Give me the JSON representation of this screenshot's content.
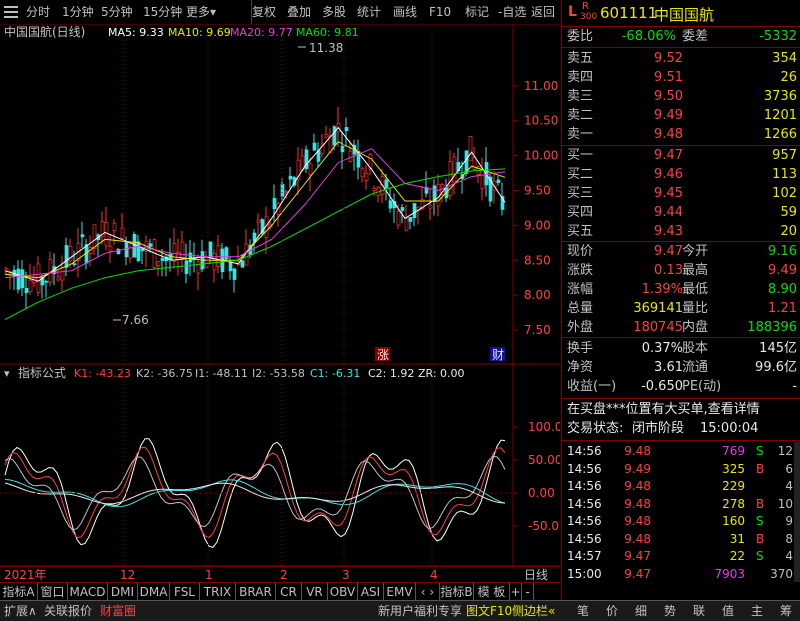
{
  "toolbar": {
    "items": [
      "分时",
      "1分钟",
      "5分钟",
      "15分钟",
      "更多▾",
      "复权",
      "叠加",
      "多股",
      "统计",
      "画线",
      "F10",
      "标记",
      "-自选",
      "返回"
    ]
  },
  "chart": {
    "title": "中国国航(日线)",
    "ma": [
      {
        "label": "MA5: 9.33",
        "color": "#ffffff"
      },
      {
        "label": "MA10: 9.69",
        "color": "#e8e800"
      },
      {
        "label": "MA20: 9.77",
        "color": "#e040e0"
      },
      {
        "label": "MA60: 9.81",
        "color": "#00e000"
      }
    ],
    "price_ticks": [
      "11.00",
      "10.50",
      "10.00",
      "9.50",
      "9.00",
      "8.50",
      "8.00",
      "7.50"
    ],
    "high_label": "11.38",
    "low_label": "7.66",
    "marker_zhang": "涨",
    "marker_cai": "财",
    "indicator": {
      "name": "指标公式",
      "values": [
        {
          "label": "K1: -43.23",
          "color": "#ff4040"
        },
        {
          "label": "K2: -36.75",
          "color": "#c0c0c0"
        },
        {
          "label": "I1: -48.11",
          "color": "#c0c0c0"
        },
        {
          "label": "I2: -53.58",
          "color": "#c0c0c0"
        },
        {
          "label": "C1: -6.31",
          "color": "#40e0e0"
        },
        {
          "label": "C2: 1.92",
          "color": "#e8e8e8"
        },
        {
          "label": "ZR: 0.00",
          "color": "#e8e8e8"
        }
      ],
      "ticks": [
        "100.0",
        "50.00",
        "0.00",
        "-50.00"
      ]
    },
    "x_labels": [
      "2021年",
      "12",
      "1",
      "2",
      "3",
      "4"
    ],
    "period": "日线"
  },
  "chart_data": {
    "type": "line",
    "title": "中国国航(日线)",
    "xlabel": "",
    "ylabel": "",
    "ylim": [
      7.3,
      11.6
    ],
    "x": [
      "2021年",
      "12",
      "1",
      "2",
      "3",
      "4"
    ],
    "series": [
      {
        "name": "MA5",
        "values": [
          8.35,
          8.2,
          8.55,
          8.9,
          8.7,
          8.5,
          8.55,
          8.45,
          9.1,
          9.85,
          10.4,
          9.8,
          9.1,
          9.4,
          10.05,
          9.33
        ]
      },
      {
        "name": "MA10",
        "values": [
          8.3,
          8.25,
          8.45,
          8.8,
          8.75,
          8.55,
          8.5,
          8.5,
          9.0,
          9.6,
          10.2,
          9.95,
          9.35,
          9.35,
          9.85,
          9.69
        ]
      },
      {
        "name": "MA20",
        "values": [
          8.25,
          8.3,
          8.35,
          8.6,
          8.7,
          8.6,
          8.55,
          8.55,
          8.8,
          9.3,
          9.9,
          10.1,
          9.6,
          9.5,
          9.7,
          9.77
        ]
      },
      {
        "name": "MA60",
        "values": [
          7.65,
          7.9,
          8.1,
          8.25,
          8.35,
          8.4,
          8.45,
          8.5,
          8.7,
          8.95,
          9.2,
          9.45,
          9.6,
          9.7,
          9.78,
          9.81
        ]
      }
    ]
  },
  "quote": {
    "code": "601111",
    "name": "中国国航",
    "badge_l": "L",
    "badge_r": "R",
    "badge_num": "300",
    "weibi_label": "委比",
    "weibi": "-68.06%",
    "weicha_label": "委差",
    "weicha": "-5332",
    "sell": [
      {
        "label": "卖五",
        "price": "9.52",
        "vol": "354"
      },
      {
        "label": "卖四",
        "price": "9.51",
        "vol": "26"
      },
      {
        "label": "卖三",
        "price": "9.50",
        "vol": "3736"
      },
      {
        "label": "卖二",
        "price": "9.49",
        "vol": "1201"
      },
      {
        "label": "卖一",
        "price": "9.48",
        "vol": "1266"
      }
    ],
    "buy": [
      {
        "label": "买一",
        "price": "9.47",
        "vol": "957"
      },
      {
        "label": "买二",
        "price": "9.46",
        "vol": "113"
      },
      {
        "label": "买三",
        "price": "9.45",
        "vol": "102"
      },
      {
        "label": "买四",
        "price": "9.44",
        "vol": "59"
      },
      {
        "label": "买五",
        "price": "9.43",
        "vol": "20"
      }
    ],
    "stats": [
      {
        "l1": "现价",
        "v1": "9.47",
        "c1": "red",
        "l2": "今开",
        "v2": "9.16",
        "c2": "green"
      },
      {
        "l1": "涨跌",
        "v1": "0.13",
        "c1": "red",
        "l2": "最高",
        "v2": "9.49",
        "c2": "red"
      },
      {
        "l1": "涨幅",
        "v1": "1.39%",
        "c1": "red",
        "l2": "最低",
        "v2": "8.90",
        "c2": "green"
      },
      {
        "l1": "总量",
        "v1": "369141",
        "c1": "yellow",
        "l2": "量比",
        "v2": "1.21",
        "c2": "red"
      },
      {
        "l1": "外盘",
        "v1": "180745",
        "c1": "red",
        "l2": "内盘",
        "v2": "188396",
        "c2": "green"
      }
    ],
    "stats2": [
      {
        "l1": "换手",
        "v1": "0.37%",
        "l2": "股本",
        "v2": "145亿"
      },
      {
        "l1": "净资",
        "v1": "3.61",
        "l2": "流通",
        "v2": "99.6亿"
      },
      {
        "l1": "收益(一)",
        "v1": "-0.650",
        "l2": "PE(动)",
        "v2": "-"
      }
    ],
    "notice": "在买盘***位置有大买单,查看详情",
    "trade_state_label": "交易状态:",
    "trade_state": "闭市阶段",
    "trade_time": "15:00:04",
    "ticks": [
      {
        "t": "14:56",
        "p": "9.48",
        "v": "769",
        "bs": "S",
        "vc": "magenta",
        "bc": "green",
        "n": "12"
      },
      {
        "t": "14:56",
        "p": "9.49",
        "v": "325",
        "bs": "B",
        "vc": "yellow",
        "bc": "red",
        "n": "6"
      },
      {
        "t": "14:56",
        "p": "9.48",
        "v": "229",
        "bs": "",
        "vc": "yellow",
        "bc": "gray",
        "n": "4"
      },
      {
        "t": "14:56",
        "p": "9.48",
        "v": "278",
        "bs": "B",
        "vc": "yellow",
        "bc": "red",
        "n": "10"
      },
      {
        "t": "14:56",
        "p": "9.48",
        "v": "160",
        "bs": "S",
        "vc": "yellow",
        "bc": "green",
        "n": "9"
      },
      {
        "t": "14:56",
        "p": "9.48",
        "v": "31",
        "bs": "B",
        "vc": "yellow",
        "bc": "red",
        "n": "8"
      },
      {
        "t": "14:57",
        "p": "9.47",
        "v": "22",
        "bs": "S",
        "vc": "yellow",
        "bc": "green",
        "n": "4"
      },
      {
        "t": "15:00",
        "p": "9.47",
        "v": "7903",
        "bs": "",
        "vc": "magenta",
        "bc": "gray",
        "n": "370"
      }
    ]
  },
  "tabs": [
    "指标A",
    "窗口",
    "MACD",
    "DMI",
    "DMA",
    "FSL",
    "TRIX",
    "BRAR",
    "CR",
    "VR",
    "OBV",
    "ASI",
    "EMV",
    "‹ ›",
    "指标B",
    "模 板",
    "+",
    "-"
  ],
  "status": {
    "left": [
      {
        "label": "扩展∧",
        "cls": ""
      },
      {
        "label": "关联报价",
        "cls": ""
      },
      {
        "label": "财富圈",
        "cls": "r"
      }
    ],
    "right": [
      {
        "label": "新用户福利专享",
        "cls": ""
      },
      {
        "label": "图文F10",
        "cls": "y"
      },
      {
        "label": "侧边栏«",
        "cls": "y"
      }
    ],
    "panel_buttons": [
      "笔",
      "价",
      "细",
      "势",
      "联",
      "值",
      "主",
      "筹"
    ]
  }
}
